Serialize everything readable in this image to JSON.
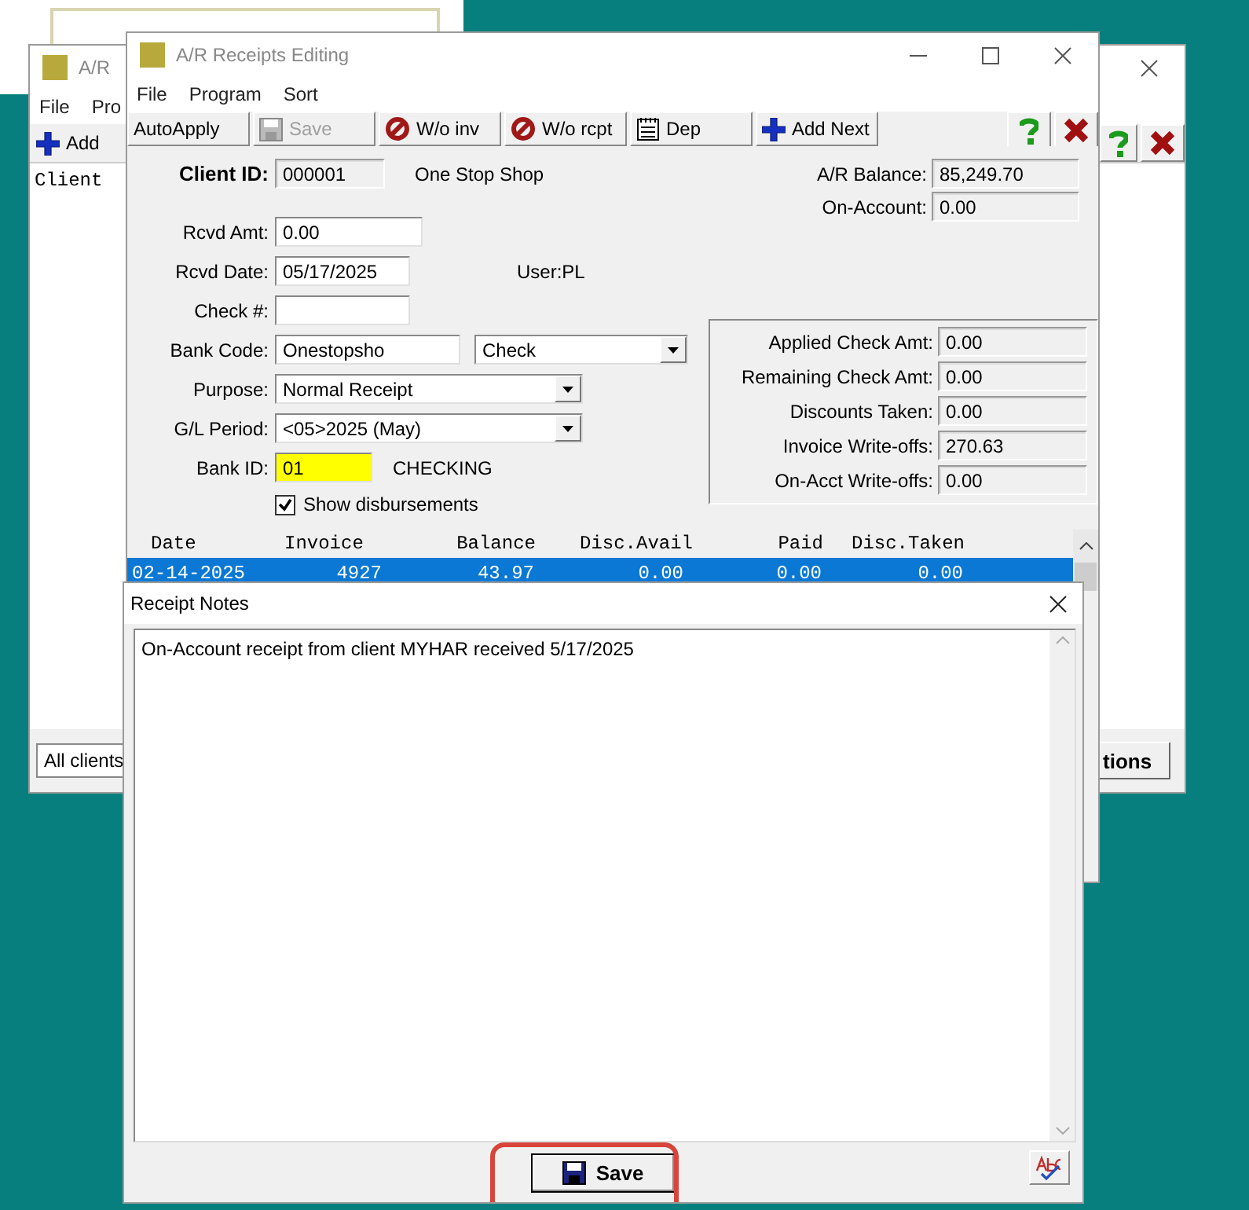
{
  "back_window": {
    "title": "A/R",
    "menu": [
      "File",
      "Pro"
    ],
    "toolbar": [
      {
        "label": "Add",
        "kind": "add"
      }
    ],
    "tools": [
      {
        "kind": "help"
      },
      {
        "kind": "close"
      }
    ],
    "columns": [
      "Client"
    ],
    "filter": "All clients",
    "button": "tions"
  },
  "window": {
    "title": "A/R Receipts Editing",
    "menu": [
      "File",
      "Program",
      "Sort"
    ],
    "toolbar": [
      {
        "label": "AutoApply",
        "kind": "text",
        "disabled": false
      },
      {
        "label": "Save",
        "kind": "save",
        "disabled": true
      },
      {
        "label": "W/o inv",
        "kind": "void",
        "disabled": false
      },
      {
        "label": "W/o rcpt",
        "kind": "void",
        "disabled": false
      },
      {
        "label": "Dep",
        "kind": "notes",
        "disabled": false
      },
      {
        "label": "Add Next",
        "kind": "add",
        "disabled": false
      }
    ],
    "tools": [
      {
        "kind": "help"
      },
      {
        "kind": "close"
      }
    ]
  },
  "client": {
    "label": "Client ID:",
    "id": "000001",
    "name": "One Stop Shop"
  },
  "balances": [
    {
      "label": "A/R Balance:",
      "value": "85,249.70"
    },
    {
      "label": "On-Account:",
      "value": "0.00"
    }
  ],
  "form": [
    {
      "label": "Rcvd Amt:",
      "fields": [
        {
          "kind": "input",
          "value": "0.00",
          "highlighted": false
        }
      ]
    },
    {
      "label": "Rcvd Date:",
      "fields": [
        {
          "kind": "input",
          "value": "05/17/2025",
          "highlighted": false
        }
      ],
      "note": "User:PL"
    },
    {
      "label": "Check #:",
      "fields": [
        {
          "kind": "input",
          "highlighted": false
        }
      ]
    },
    {
      "label": "Bank Code:",
      "fields": [
        {
          "kind": "input",
          "value": "Onestopsho",
          "highlighted": false
        },
        {
          "kind": "select",
          "value": "Check"
        }
      ]
    },
    {
      "label": "Purpose:",
      "fields": [
        {
          "kind": "select",
          "value": "Normal Receipt"
        }
      ]
    },
    {
      "label": "G/L Period:",
      "fields": [
        {
          "kind": "select",
          "value": "<05>2025 (May)"
        }
      ]
    },
    {
      "label": "Bank ID:",
      "fields": [
        {
          "kind": "input",
          "value": "01",
          "highlighted": true
        }
      ],
      "note": "CHECKING"
    }
  ],
  "show_disbursements": {
    "label": "Show disbursements",
    "checked": true
  },
  "totals": [
    {
      "label": "Applied Check Amt:",
      "value": "0.00"
    },
    {
      "label": "Remaining Check Amt:",
      "value": "0.00"
    },
    {
      "label": "Discounts Taken:",
      "value": "0.00"
    },
    {
      "label": "Invoice Write-offs:",
      "value": "270.63"
    },
    {
      "label": "On-Acct Write-offs:",
      "value": "0.00"
    }
  ],
  "table": {
    "columns": [
      "Date",
      "Invoice",
      "Balance",
      "Disc.Avail",
      "Paid",
      "Disc.Taken"
    ],
    "rows": [
      {
        "cells": [
          "02-14-2025",
          "4927",
          "43.97",
          "0.00",
          "0.00",
          "0.00"
        ],
        "selected": true
      }
    ]
  },
  "notes_dialog": {
    "title": "Receipt Notes",
    "text": "On-Account receipt from client MYHAR received 5/17/2025",
    "save": {
      "label": "Save",
      "highlighted": true
    }
  }
}
